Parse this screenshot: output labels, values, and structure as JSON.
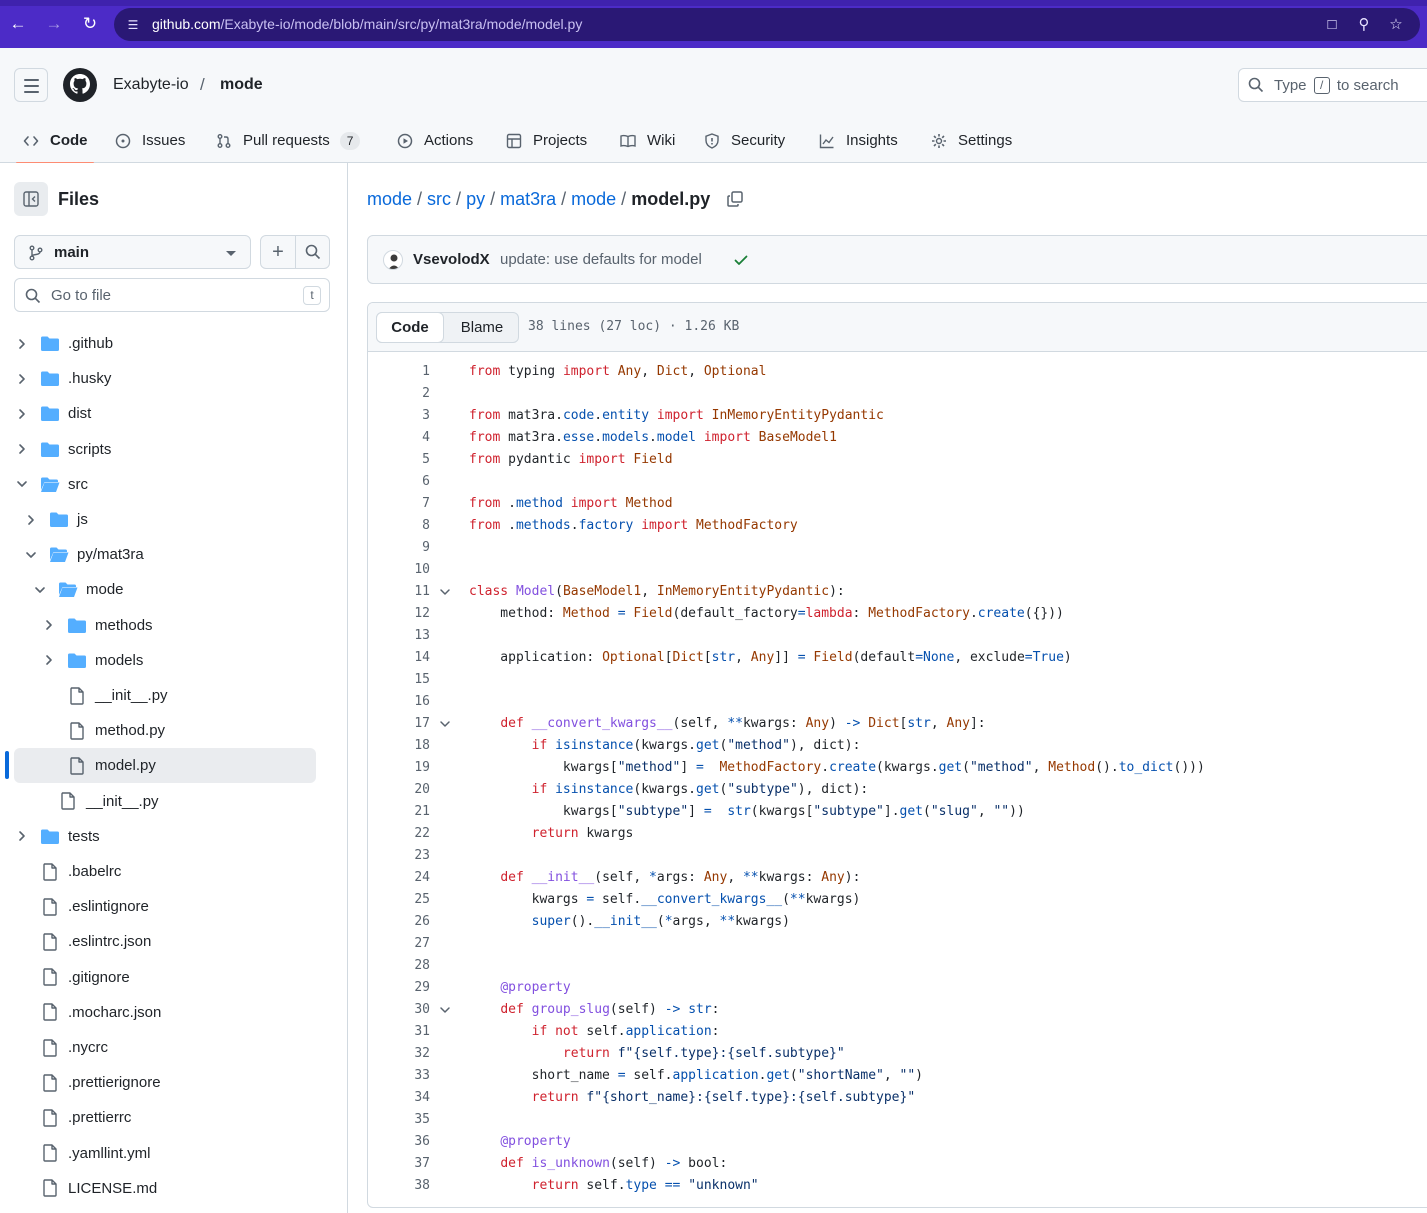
{
  "browser": {
    "url_host": "github.com",
    "url_path": "/Exabyte-io/mode/blob/main/src/py/mat3ra/mode/model.py"
  },
  "header": {
    "owner": "Exabyte-io",
    "separator": "/",
    "repo": "mode",
    "search_prefix": "Type",
    "search_key": "/",
    "search_suffix": "to search"
  },
  "tabs": [
    {
      "label": "Code",
      "icon": "code-icon"
    },
    {
      "label": "Issues",
      "icon": "issue-icon"
    },
    {
      "label": "Pull requests",
      "icon": "pull-request-icon",
      "count": "7"
    },
    {
      "label": "Actions",
      "icon": "play-icon"
    },
    {
      "label": "Projects",
      "icon": "table-icon"
    },
    {
      "label": "Wiki",
      "icon": "book-icon"
    },
    {
      "label": "Security",
      "icon": "shield-icon"
    },
    {
      "label": "Insights",
      "icon": "graph-icon"
    },
    {
      "label": "Settings",
      "icon": "gear-icon"
    }
  ],
  "sidebar": {
    "title": "Files",
    "branch": "main",
    "goto_placeholder": "Go to file",
    "goto_key": "t",
    "tree": [
      {
        "label": ".github",
        "type": "folder",
        "depth": 0,
        "expanded": false
      },
      {
        "label": ".husky",
        "type": "folder",
        "depth": 0,
        "expanded": false
      },
      {
        "label": "dist",
        "type": "folder",
        "depth": 0,
        "expanded": false
      },
      {
        "label": "scripts",
        "type": "folder",
        "depth": 0,
        "expanded": false
      },
      {
        "label": "src",
        "type": "folder",
        "depth": 0,
        "expanded": true
      },
      {
        "label": "js",
        "type": "folder",
        "depth": 1,
        "expanded": false
      },
      {
        "label": "py/mat3ra",
        "type": "folder",
        "depth": 1,
        "expanded": true
      },
      {
        "label": "mode",
        "type": "folder",
        "depth": 2,
        "expanded": true
      },
      {
        "label": "methods",
        "type": "folder",
        "depth": 3,
        "expanded": false
      },
      {
        "label": "models",
        "type": "folder",
        "depth": 3,
        "expanded": false
      },
      {
        "label": "__init__.py",
        "type": "file",
        "depth": 3
      },
      {
        "label": "method.py",
        "type": "file",
        "depth": 3
      },
      {
        "label": "model.py",
        "type": "file",
        "depth": 3,
        "selected": true
      },
      {
        "label": "__init__.py",
        "type": "file",
        "depth": 2
      },
      {
        "label": "tests",
        "type": "folder",
        "depth": 0,
        "expanded": false
      },
      {
        "label": ".babelrc",
        "type": "file",
        "depth": 0
      },
      {
        "label": ".eslintignore",
        "type": "file",
        "depth": 0
      },
      {
        "label": ".eslintrc.json",
        "type": "file",
        "depth": 0
      },
      {
        "label": ".gitignore",
        "type": "file",
        "depth": 0
      },
      {
        "label": ".mocharc.json",
        "type": "file",
        "depth": 0
      },
      {
        "label": ".nycrc",
        "type": "file",
        "depth": 0
      },
      {
        "label": ".prettierignore",
        "type": "file",
        "depth": 0
      },
      {
        "label": ".prettierrc",
        "type": "file",
        "depth": 0
      },
      {
        "label": ".yamllint.yml",
        "type": "file",
        "depth": 0
      },
      {
        "label": "LICENSE.md",
        "type": "file",
        "depth": 0
      }
    ]
  },
  "breadcrumb": {
    "parts": [
      "mode",
      "src",
      "py",
      "mat3ra",
      "mode"
    ],
    "current": "model.py"
  },
  "commit": {
    "author": "VsevolodX",
    "message": "update: use defaults for model",
    "status": "success"
  },
  "file": {
    "tab_code": "Code",
    "tab_blame": "Blame",
    "meta": "38 lines (27 loc) · 1.26 KB",
    "lines": [
      {
        "n": "1",
        "text": "from typing import Any, Dict, Optional"
      },
      {
        "n": "2",
        "text": ""
      },
      {
        "n": "3",
        "text": "from mat3ra.code.entity import InMemoryEntityPydantic"
      },
      {
        "n": "4",
        "text": "from mat3ra.esse.models.model import BaseModel1"
      },
      {
        "n": "5",
        "text": "from pydantic import Field"
      },
      {
        "n": "6",
        "text": ""
      },
      {
        "n": "7",
        "text": "from .method import Method"
      },
      {
        "n": "8",
        "text": "from .methods.factory import MethodFactory"
      },
      {
        "n": "9",
        "text": ""
      },
      {
        "n": "10",
        "text": ""
      },
      {
        "n": "11",
        "text": "class Model(BaseModel1, InMemoryEntityPydantic):",
        "fold": true
      },
      {
        "n": "12",
        "text": "    method: Method = Field(default_factory=lambda: MethodFactory.create({}))"
      },
      {
        "n": "13",
        "text": ""
      },
      {
        "n": "14",
        "text": "    application: Optional[Dict[str, Any]] = Field(default=None, exclude=True)"
      },
      {
        "n": "15",
        "text": ""
      },
      {
        "n": "16",
        "text": ""
      },
      {
        "n": "17",
        "text": "    def __convert_kwargs__(self, **kwargs: Any) -> Dict[str, Any]:",
        "fold": true
      },
      {
        "n": "18",
        "text": "        if isinstance(kwargs.get(\"method\"), dict):"
      },
      {
        "n": "19",
        "text": "            kwargs[\"method\"] =  MethodFactory.create(kwargs.get(\"method\", Method().to_dict()))"
      },
      {
        "n": "20",
        "text": "        if isinstance(kwargs.get(\"subtype\"), dict):"
      },
      {
        "n": "21",
        "text": "            kwargs[\"subtype\"] =  str(kwargs[\"subtype\"].get(\"slug\", \"\"))"
      },
      {
        "n": "22",
        "text": "        return kwargs"
      },
      {
        "n": "23",
        "text": ""
      },
      {
        "n": "24",
        "text": "    def __init__(self, *args: Any, **kwargs: Any):"
      },
      {
        "n": "25",
        "text": "        kwargs = self.__convert_kwargs__(**kwargs)"
      },
      {
        "n": "26",
        "text": "        super().__init__(*args, **kwargs)"
      },
      {
        "n": "27",
        "text": ""
      },
      {
        "n": "28",
        "text": ""
      },
      {
        "n": "29",
        "text": "    @property"
      },
      {
        "n": "30",
        "text": "    def group_slug(self) -> str:",
        "fold": true
      },
      {
        "n": "31",
        "text": "        if not self.application:"
      },
      {
        "n": "32",
        "text": "            return f\"{self.type}:{self.subtype}\""
      },
      {
        "n": "33",
        "text": "        short_name = self.application.get(\"shortName\", \"\")"
      },
      {
        "n": "34",
        "text": "        return f\"{short_name}:{self.type}:{self.subtype}\""
      },
      {
        "n": "35",
        "text": ""
      },
      {
        "n": "36",
        "text": "    @property"
      },
      {
        "n": "37",
        "text": "    def is_unknown(self) -> bool:"
      },
      {
        "n": "38",
        "text": "        return self.type == \"unknown\""
      }
    ]
  },
  "colors": {
    "browser_bar": "#4c2bc7",
    "link": "#0969da",
    "folder": "#54aeff",
    "active_tab_underline": "#fd8c73",
    "success": "#1a7f37"
  }
}
